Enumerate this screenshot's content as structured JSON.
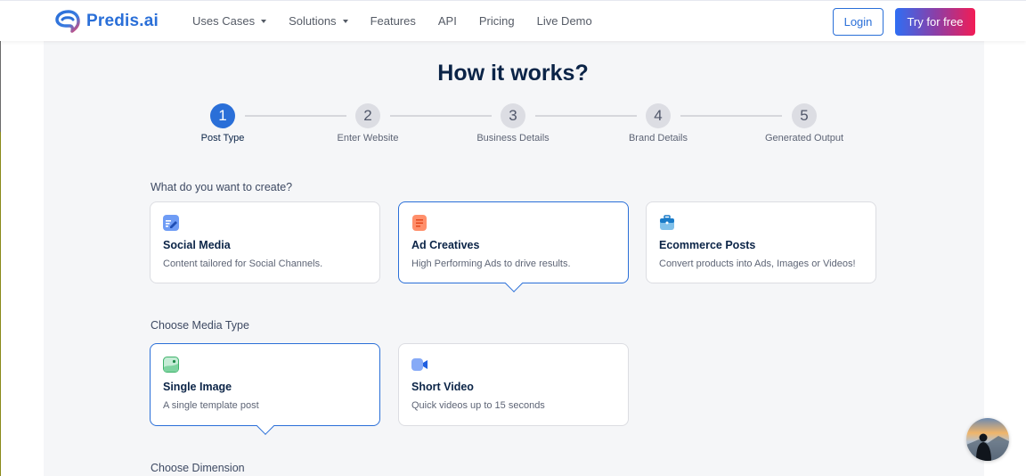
{
  "header": {
    "logo_text": "Predis.ai",
    "nav": [
      {
        "label": "Uses Cases",
        "has_dropdown": true
      },
      {
        "label": "Solutions",
        "has_dropdown": true
      },
      {
        "label": "Features",
        "has_dropdown": false
      },
      {
        "label": "API",
        "has_dropdown": false
      },
      {
        "label": "Pricing",
        "has_dropdown": false
      },
      {
        "label": "Live Demo",
        "has_dropdown": false
      }
    ],
    "login_label": "Login",
    "try_label": "Try for free"
  },
  "main": {
    "title": "How it works?",
    "steps": [
      {
        "number": "1",
        "label": "Post Type",
        "active": true
      },
      {
        "number": "2",
        "label": "Enter Website",
        "active": false
      },
      {
        "number": "3",
        "label": "Business Details",
        "active": false
      },
      {
        "number": "4",
        "label": "Brand Details",
        "active": false
      },
      {
        "number": "5",
        "label": "Generated Output",
        "active": false
      }
    ],
    "create_section": {
      "label": "What do you want to create?",
      "options": [
        {
          "title": "Social Media",
          "desc": "Content tailored for Social Channels.",
          "icon": "edit-note-icon",
          "selected": false
        },
        {
          "title": "Ad Creatives",
          "desc": "High Performing Ads to drive results.",
          "icon": "document-lines-icon",
          "selected": true
        },
        {
          "title": "Ecommerce Posts",
          "desc": "Convert products into Ads, Images or Videos!",
          "icon": "briefcase-icon",
          "selected": false
        }
      ]
    },
    "media_section": {
      "label": "Choose Media Type",
      "options": [
        {
          "title": "Single Image",
          "desc": "A single template post",
          "icon": "image-icon",
          "selected": true
        },
        {
          "title": "Short Video",
          "desc": "Quick videos up to 15 seconds",
          "icon": "video-camera-icon",
          "selected": false
        }
      ]
    },
    "dimension_section": {
      "label": "Choose Dimension"
    }
  },
  "colors": {
    "brand_blue": "#2a6fd8",
    "gradient_start": "#2f6ef3",
    "gradient_end": "#f21c55",
    "title_navy": "#0b2447",
    "panel_bg": "#f5f6f8"
  }
}
